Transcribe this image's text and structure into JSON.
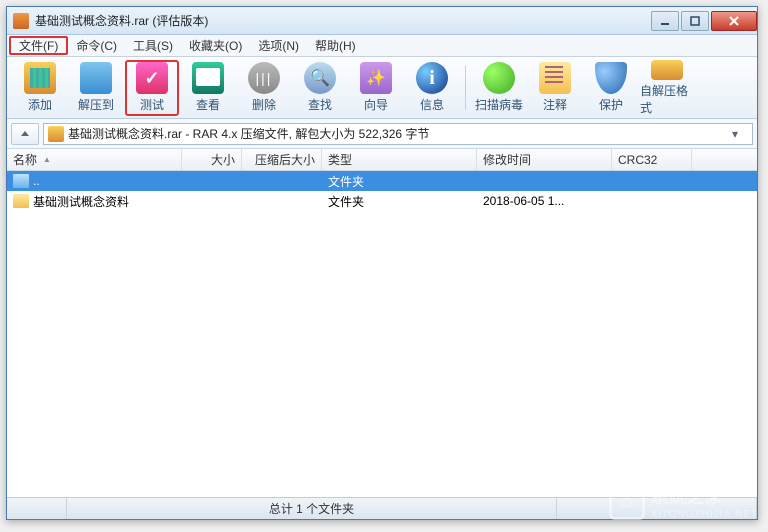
{
  "title": "基础测试概念资料.rar (评估版本)",
  "menu": {
    "file": "文件(F)",
    "command": "命令(C)",
    "tool": "工具(S)",
    "favorite": "收藏夹(O)",
    "option": "选项(N)",
    "help": "帮助(H)"
  },
  "toolbar": {
    "add": "添加",
    "extract": "解压到",
    "test": "测试",
    "view": "查看",
    "delete": "删除",
    "find": "查找",
    "wizard": "向导",
    "info": "信息",
    "virus": "扫描病毒",
    "comment": "注释",
    "protect": "保护",
    "sfx": "自解压格式"
  },
  "address": "基础测试概念资料.rar - RAR 4.x 压缩文件, 解包大小为 522,326 字节",
  "columns": {
    "name": "名称",
    "size": "大小",
    "packed": "压缩后大小",
    "type": "类型",
    "mtime": "修改时间",
    "crc": "CRC32"
  },
  "rows": [
    {
      "name": "..",
      "type": "文件夹",
      "mtime": "",
      "icon": "folder-up",
      "selected": true
    },
    {
      "name": "基础测试概念资料",
      "type": "文件夹",
      "mtime": "2018-06-05 1...",
      "icon": "folder",
      "selected": false
    }
  ],
  "status": {
    "left": "",
    "mid": "总计 1 个文件夹",
    "right": ""
  },
  "watermark": {
    "text": "系统之家",
    "url": "XITONGZHIJIA.NET"
  }
}
